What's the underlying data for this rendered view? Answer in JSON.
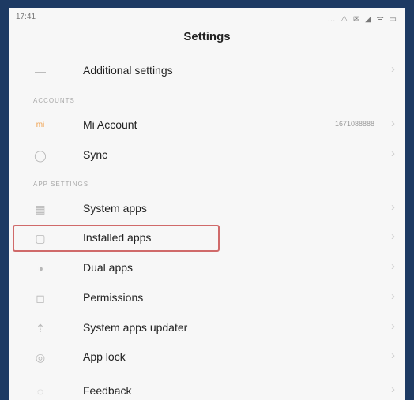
{
  "status": {
    "time": "17:41",
    "icons": "… ⚠ ✉ ◢ ᯤ ▭"
  },
  "header": {
    "title": "Settings"
  },
  "sections": {
    "accounts": "ACCOUNTS",
    "app_settings": "APP SETTINGS"
  },
  "items": [
    {
      "label": "Additional settings",
      "icon": "dots-icon",
      "glyph": "—"
    },
    {
      "label": "Mi Account",
      "icon": "mi-icon",
      "glyph": "mi",
      "value": "1671088888"
    },
    {
      "label": "Sync",
      "icon": "sync-icon",
      "glyph": "◯"
    },
    {
      "label": "System apps",
      "icon": "system-apps-icon",
      "glyph": "▦"
    },
    {
      "label": "Installed apps",
      "icon": "installed-apps-icon",
      "glyph": "▢"
    },
    {
      "label": "Dual apps",
      "icon": "dual-apps-icon",
      "glyph": "◑"
    },
    {
      "label": "Permissions",
      "icon": "permissions-icon",
      "glyph": "◻"
    },
    {
      "label": "System apps updater",
      "icon": "updater-icon",
      "glyph": "⇡"
    },
    {
      "label": "App lock",
      "icon": "lock-icon",
      "glyph": "◎"
    },
    {
      "label": "Feedback",
      "icon": "feedback-icon",
      "glyph": "◌"
    }
  ],
  "chevron": "›",
  "colors": {
    "highlight": "#d06a6a",
    "frame": "#1d3a63",
    "background": "#f7f7f7"
  }
}
